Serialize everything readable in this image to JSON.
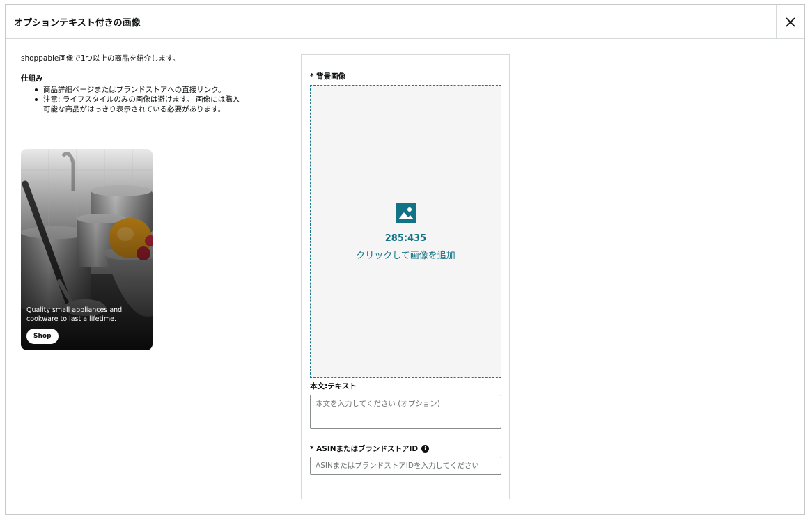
{
  "modal": {
    "title": "オプションテキスト付きの画像",
    "close_icon": "close-icon"
  },
  "left": {
    "intro": "shoppable画像で1つ以上の商品を紹介します。",
    "how_title": "仕組み",
    "how_items": [
      "商品詳細ページまたはブランドストアへの直接リンク。",
      "注意: ライフスタイルのみの画像は避けます。 画像には購入可能な商品がはっきり表示されている必要があります。"
    ],
    "preview": {
      "caption": "Quality small appliances and cookware to last a lifetime.",
      "shop_label": "Shop"
    }
  },
  "form": {
    "background_label": "* 背景画像",
    "upload": {
      "icon": "image-icon",
      "ratio": "285:435",
      "add_text": "クリックして画像を追加"
    },
    "body_label": "本文:テキスト",
    "body_placeholder": "本文を入力してください (オプション)",
    "asin_label": "* ASINまたはブランドストアID",
    "asin_info_icon": "info-icon",
    "asin_placeholder": "ASINまたはブランドストアIDを入力してください"
  },
  "colors": {
    "accent": "#127286",
    "dashed_border": "#1a7a8a",
    "upload_bg": "#f5f5f5",
    "text": "#0f1111"
  }
}
